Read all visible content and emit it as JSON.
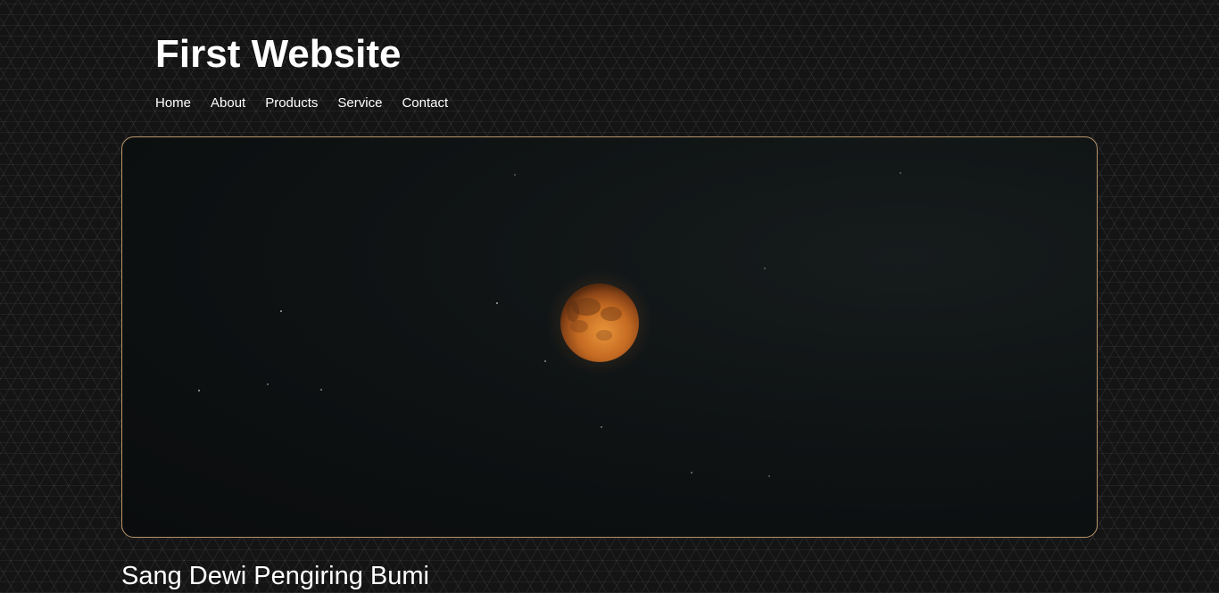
{
  "header": {
    "site_title": "First Website"
  },
  "nav": {
    "items": [
      {
        "label": "Home"
      },
      {
        "label": "About"
      },
      {
        "label": "Products"
      },
      {
        "label": "Service"
      },
      {
        "label": "Contact"
      }
    ]
  },
  "hero": {
    "image_subject": "blood moon over night sky",
    "border_color": "#b8956a"
  },
  "content": {
    "section_title": "Sang Dewi Pengiring Bumi"
  }
}
